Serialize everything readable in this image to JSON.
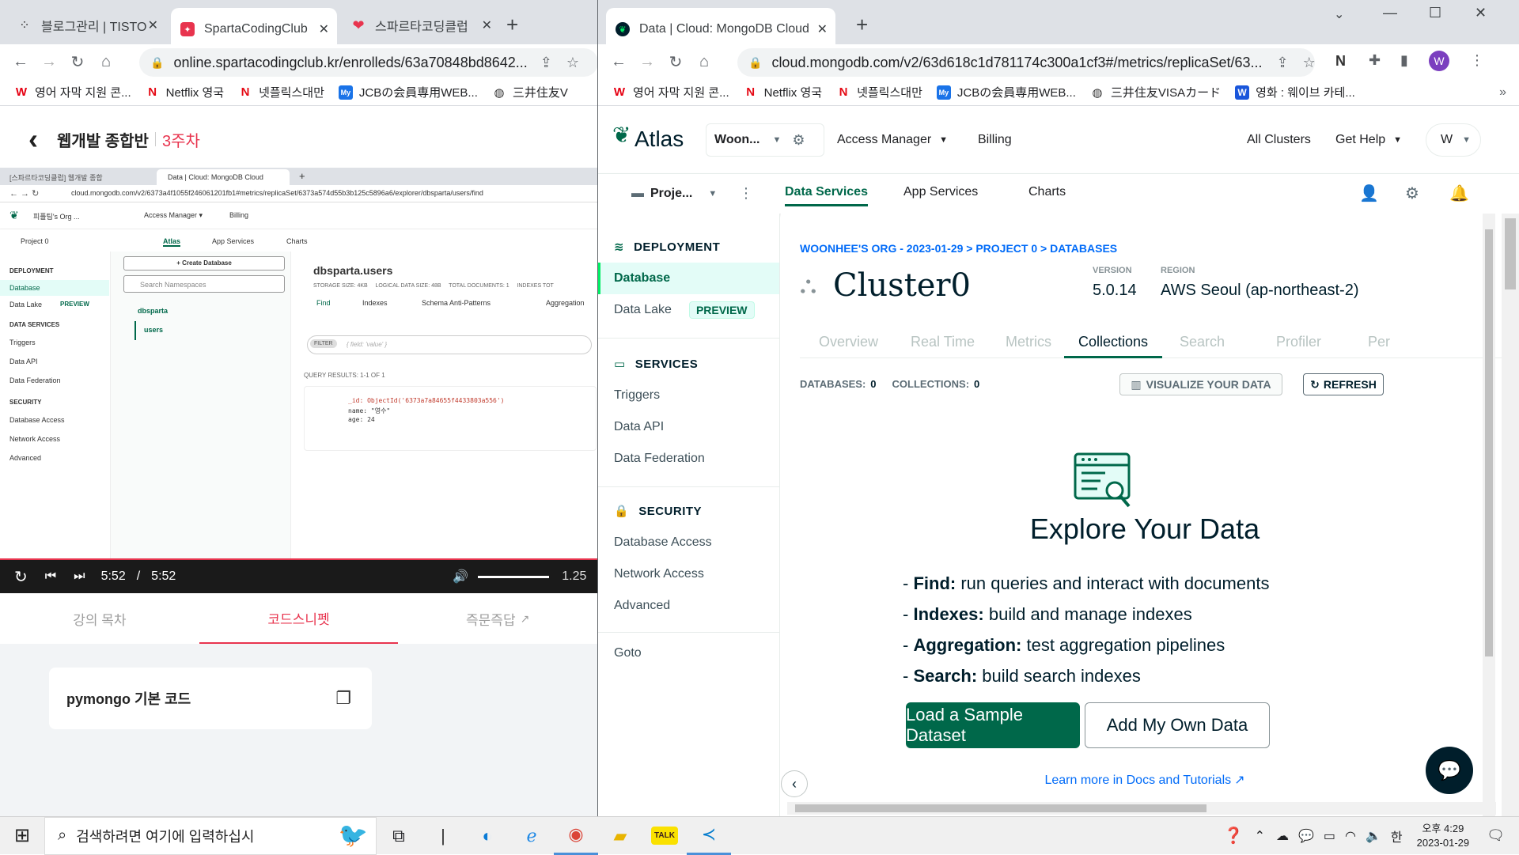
{
  "left_browser": {
    "tabs": [
      {
        "title": "블로그관리 | TISTO",
        "favicon": "grid-icon"
      },
      {
        "title": "SpartaCodingClub",
        "favicon": "sparta-icon"
      },
      {
        "title": "스파르타코딩클럽",
        "favicon": "sparta-heart-icon"
      }
    ],
    "url": "online.spartacodingclub.kr/enrolleds/63a70848bd8642...",
    "bookmarks": [
      "영어 자막 지원 콘...",
      "Netflix 영국",
      "넷플릭스대만",
      "JCBの会員専用WEB...",
      "三井住友V"
    ]
  },
  "right_browser": {
    "tab_title": "Data | Cloud: MongoDB Cloud",
    "url": "cloud.mongodb.com/v2/63d618c1d781174c300a1cf3#/metrics/replicaSet/63...",
    "bookmarks": [
      "영어 자막 지원 콘...",
      "Netflix 영국",
      "넷플릭스대만",
      "JCBの会員専用WEB...",
      "三井住友VISAカード",
      "영화 : 웨이브 카테..."
    ],
    "profile_initial": "W"
  },
  "course": {
    "back": "‹",
    "title": "웹개발 종합반",
    "week": "3주차",
    "time_current": "5:52",
    "time_sep": "/",
    "time_total": "5:52",
    "speed": "1.25",
    "tabs": [
      "강의 목차",
      "코드스니펫",
      "즉문즉답"
    ],
    "snippet_title": "pymongo 기본 코드"
  },
  "mini": {
    "tab1": "[스파르타코딩클럽] 웹개발 종합",
    "tab2": "Data | Cloud: MongoDB Cloud",
    "url": "cloud.mongodb.com/v2/6373a4f1055f246061201fb1#metrics/replicaSet/6373a574d55b3b125c5896a6/explorer/dbsparta/users/find",
    "org": "피플팀's Org ...",
    "access": "Access Manager ▾",
    "billing": "Billing",
    "project": "Project 0",
    "nav": [
      "Atlas",
      "App Services",
      "Charts"
    ],
    "deployment": "DEPLOYMENT",
    "database": "Database",
    "datalake": "Data Lake",
    "preview": "PREVIEW",
    "services": "DATA SERVICES",
    "svc_items": [
      "Triggers",
      "Data API",
      "Data Federation"
    ],
    "security": "SECURITY",
    "sec_items": [
      "Database Access",
      "Network Access",
      "Advanced"
    ],
    "create_db": "+ Create Database",
    "search_ns": "Search Namespaces",
    "db": "dbsparta",
    "coll": "users",
    "coll_title": "dbsparta.users",
    "stats": "STORAGE SIZE: 4KB     LOGICAL DATA SIZE: 48B     TOTAL DOCUMENTS: 1     INDEXES TOT",
    "coll_tabs": [
      "Find",
      "Indexes",
      "Schema Anti-Patterns",
      "Aggregation"
    ],
    "filter": "FILTER",
    "filter_ph": "{ field: 'value' }",
    "query_results": "QUERY RESULTS: 1-1 OF 1",
    "doc_id": "_id: ObjectId('6373a7a84655f4433803a556')",
    "doc_name": "name: \"영수\"",
    "doc_age": "age: 24"
  },
  "atlas": {
    "logo": "Atlas",
    "org_short": "Woon...",
    "access_manager": "Access Manager",
    "billing": "Billing",
    "all_clusters": "All Clusters",
    "get_help": "Get Help",
    "user": "W",
    "project_short": "Proje...",
    "nav": [
      "Data Services",
      "App Services",
      "Charts"
    ],
    "sidebar": {
      "deployment": "DEPLOYMENT",
      "database": "Database",
      "data_lake": "Data Lake",
      "preview": "PREVIEW",
      "services": "SERVICES",
      "service_items": [
        "Triggers",
        "Data API",
        "Data Federation"
      ],
      "security": "SECURITY",
      "security_items": [
        "Database Access",
        "Network Access",
        "Advanced"
      ],
      "goto": "Goto"
    },
    "breadcrumb": "WOONHEE'S ORG - 2023-01-29 > PROJECT 0 > DATABASES",
    "cluster_name": "Cluster0",
    "version_label": "VERSION",
    "version": "5.0.14",
    "region_label": "REGION",
    "region": "AWS Seoul (ap-northeast-2)",
    "tabs": [
      "Overview",
      "Real Time",
      "Metrics",
      "Collections",
      "Search",
      "Profiler",
      "Per"
    ],
    "active_tab": "Collections",
    "databases_label": "DATABASES:",
    "databases_count": "0",
    "collections_label": "COLLECTIONS:",
    "collections_count": "0",
    "visualize": "VISUALIZE YOUR DATA",
    "refresh": "REFRESH",
    "explore_title": "Explore Your Data",
    "features": [
      {
        "k": "Find:",
        "v": "run queries and interact with documents"
      },
      {
        "k": "Indexes:",
        "v": "build and manage indexes"
      },
      {
        "k": "Aggregation:",
        "v": "test aggregation pipelines"
      },
      {
        "k": "Search:",
        "v": "build search indexes"
      }
    ],
    "load_sample": "Load a Sample Dataset",
    "add_own": "Add My Own Data",
    "learn_more": "Learn more in Docs and Tutorials"
  },
  "taskbar": {
    "search_placeholder": "검색하려면 여기에 입력하십시",
    "ime": "한",
    "time": "오후 4:29",
    "date": "2023-01-29"
  },
  "colors": {
    "atlas_green": "#00684a",
    "atlas_blue": "#016bf8",
    "sparta_red": "#e8344e"
  }
}
